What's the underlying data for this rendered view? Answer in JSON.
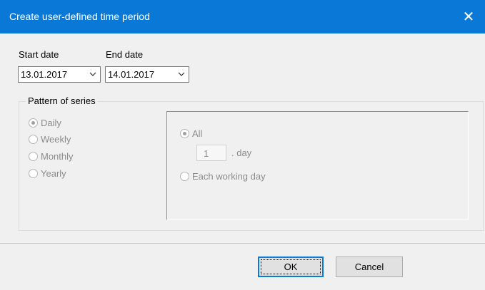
{
  "window": {
    "title": "Create user-defined time period",
    "close_glyph": "✕"
  },
  "dates": {
    "start_label": "Start date",
    "start_value": "13.01.2017",
    "end_label": "End date",
    "end_value": "14.01.2017"
  },
  "pattern": {
    "legend": "Pattern of series",
    "options": [
      {
        "label": "Daily",
        "checked": true
      },
      {
        "label": "Weekly",
        "checked": false
      },
      {
        "label": "Monthly",
        "checked": false
      },
      {
        "label": "Yearly",
        "checked": false
      }
    ],
    "daily": {
      "all_label": "All",
      "interval_value": "1",
      "interval_unit": ". day",
      "each_working_day_label": "Each working day"
    }
  },
  "buttons": {
    "ok": "OK",
    "cancel": "Cancel"
  },
  "colors": {
    "titlebar": "#0a78d7",
    "dialog_bg": "#f0f0f0",
    "disabled_text": "#8c8c8c"
  }
}
